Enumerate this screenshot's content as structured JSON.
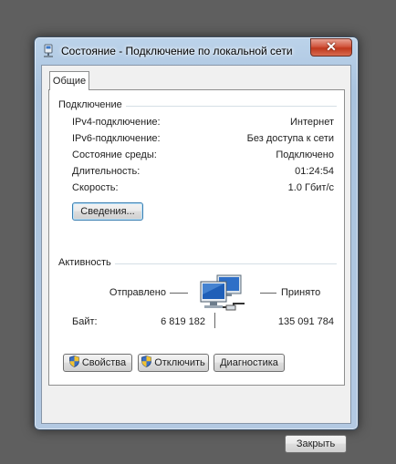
{
  "window": {
    "title": "Состояние - Подключение по локальной сети",
    "close_glyph": "✕"
  },
  "tabs": [
    {
      "label": "Общие",
      "active": true
    }
  ],
  "connection": {
    "heading": "Подключение",
    "rows": [
      {
        "label": "IPv4-подключение:",
        "value": "Интернет"
      },
      {
        "label": "IPv6-подключение:",
        "value": "Без доступа к сети"
      },
      {
        "label": "Состояние среды:",
        "value": "Подключено"
      },
      {
        "label": "Длительность:",
        "value": "01:24:54"
      },
      {
        "label": "Скорость:",
        "value": "1.0 Гбит/с"
      }
    ],
    "details_button": "Сведения..."
  },
  "activity": {
    "heading": "Активность",
    "sent_label": "Отправлено",
    "received_label": "Принято",
    "bytes_label": "Байт:",
    "bytes_sent": "6 819 182",
    "bytes_received": "135 091 784"
  },
  "buttons": {
    "properties": "Свойства",
    "disable": "Отключить",
    "diagnose": "Диагностика",
    "close": "Закрыть"
  },
  "icons": {
    "title": "network-connection-icon",
    "activity": "network-computers-icon",
    "shield": "uac-shield-icon"
  },
  "colors": {
    "frame": "#a9c3df",
    "close_button": "#c0381d",
    "focus_border": "#3c7fb1"
  }
}
